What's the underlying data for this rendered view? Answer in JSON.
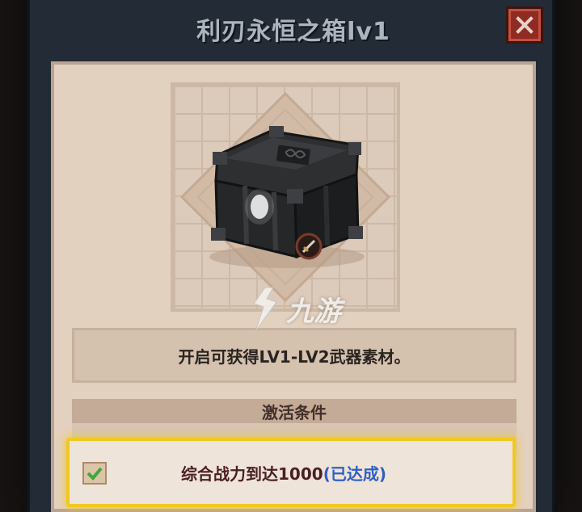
{
  "dialog": {
    "title": "利刃永恒之箱lv1",
    "close_icon": "close-icon"
  },
  "item": {
    "icon": "black-chest-icon",
    "badge_icon": "sword-badge-icon"
  },
  "description": "开启可获得LV1-LV2武器素材。",
  "conditions": {
    "header": "激活条件",
    "items": [
      {
        "text": "综合战力到达1000",
        "status": "(已达成)",
        "checked": true
      }
    ]
  },
  "watermark": {
    "text": "九游",
    "icon": "jiuyou-logo-icon"
  },
  "colors": {
    "highlight_border": "#f1c823",
    "status_blue": "#2f5fc5",
    "close_red": "#8f2b23"
  }
}
